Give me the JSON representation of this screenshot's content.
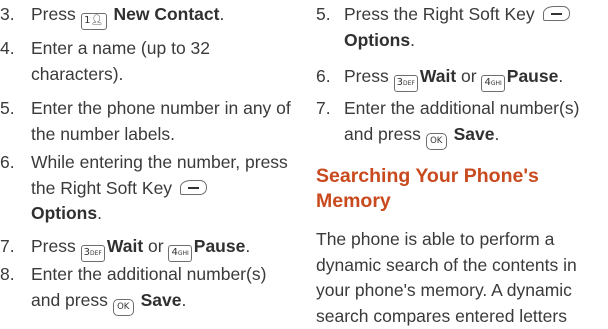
{
  "left_steps": [
    {
      "num": "3.",
      "pre": "Press ",
      "key": "1",
      "action": "New Contact"
    },
    {
      "num": "4.",
      "text": "Enter a name (up to 32 characters)."
    },
    {
      "num": "5.",
      "text": "Enter the phone number in any of the number labels."
    },
    {
      "num": "6.",
      "text": "While entering the number, press the Right Soft Key",
      "action": "Options",
      "post": "."
    },
    {
      "num": "7.",
      "pre": "Press ",
      "key1": "3DEF",
      "action1": "Wait",
      "mid": " or ",
      "key2": "4GHI",
      "action2": "Pause",
      "post": "."
    },
    {
      "num": "8.",
      "text": "Enter the additional number(s) and press ",
      "key": "OK",
      "action": "Save",
      "post": "."
    }
  ],
  "right_steps": [
    {
      "num": "5.",
      "text": "Press the Right Soft Key",
      "action": "Options",
      "post": "."
    },
    {
      "num": "6.",
      "pre": "Press ",
      "key1": "3DEF",
      "action1": "Wait",
      "mid": " or ",
      "key2": "4GHI",
      "action2": "Pause",
      "post": "."
    },
    {
      "num": "7.",
      "text": "Enter the additional number(s) and press ",
      "key": "OK",
      "action": "Save",
      "post": "."
    }
  ],
  "section": {
    "heading": "Searching Your Phone's Memory",
    "body": "The phone is able to perform a dynamic search of the contents in your phone's memory. A dynamic search compares entered letters"
  },
  "key_glyphs": {
    "one": "1",
    "three": "3",
    "three_sub": "DEF",
    "four": "4",
    "four_sub": "GHI",
    "ok": "OK"
  },
  "icons": [
    "right-soft-key-icon",
    "key-1-icon",
    "key-3-icon",
    "key-4-icon",
    "ok-key-icon"
  ],
  "colors": {
    "heading": "#c84a1e",
    "text": "#3a3a3a"
  }
}
